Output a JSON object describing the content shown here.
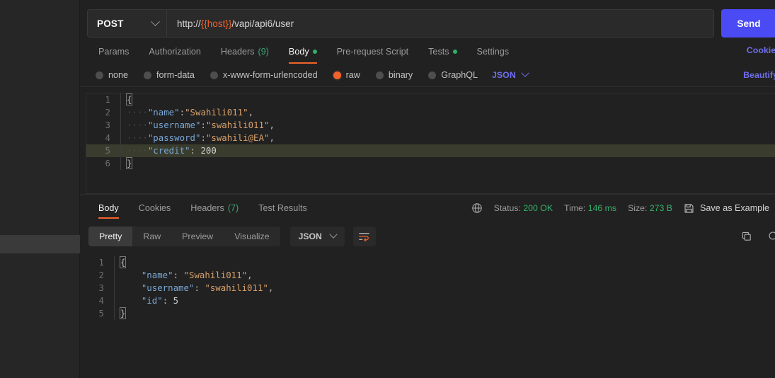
{
  "sidebar": {
    "highlighted_row": ""
  },
  "request": {
    "method": "POST",
    "url_scheme": "http://",
    "url_variable": "{{host}}",
    "url_path": "/vapi/api6/user",
    "send_label": "Send",
    "cookies_link": "Cookies",
    "beautify_link": "Beautify",
    "tabs": [
      {
        "label": "Params",
        "active": false
      },
      {
        "label": "Authorization",
        "active": false
      },
      {
        "label": "Headers",
        "count": "(9)",
        "active": false
      },
      {
        "label": "Body",
        "active": true,
        "dot": true
      },
      {
        "label": "Pre-request Script",
        "active": false
      },
      {
        "label": "Tests",
        "active": false,
        "dot": true
      },
      {
        "label": "Settings",
        "active": false
      }
    ],
    "body_types": [
      {
        "label": "none",
        "selected": false
      },
      {
        "label": "form-data",
        "selected": false
      },
      {
        "label": "x-www-form-urlencoded",
        "selected": false
      },
      {
        "label": "raw",
        "selected": true
      },
      {
        "label": "binary",
        "selected": false
      },
      {
        "label": "GraphQL",
        "selected": false
      }
    ],
    "raw_format": "JSON",
    "body_lines": [
      {
        "n": "1",
        "type": "open"
      },
      {
        "n": "2",
        "type": "kv",
        "key": "\"name\"",
        "sep": ":",
        "value": "\"Swahili011\"",
        "value_kind": "string",
        "trail": ","
      },
      {
        "n": "3",
        "type": "kv",
        "key": "\"username\"",
        "sep": ":",
        "value": "\"swahili011\"",
        "value_kind": "string",
        "trail": ","
      },
      {
        "n": "4",
        "type": "kv",
        "key": "\"password\"",
        "sep": ":",
        "value": "\"swahili@EA\"",
        "value_kind": "string",
        "trail": ","
      },
      {
        "n": "5",
        "type": "kv",
        "key": "\"credit\"",
        "sep": ": ",
        "value": "200",
        "value_kind": "number",
        "trail": "",
        "highlight": true
      },
      {
        "n": "6",
        "type": "close"
      }
    ]
  },
  "response": {
    "tabs": [
      {
        "label": "Body",
        "active": true
      },
      {
        "label": "Cookies",
        "active": false
      },
      {
        "label": "Headers",
        "count": "(7)",
        "active": false
      },
      {
        "label": "Test Results",
        "active": false
      }
    ],
    "status_label": "Status:",
    "status_value": "200 OK",
    "time_label": "Time:",
    "time_value": "146 ms",
    "size_label": "Size:",
    "size_value": "273 B",
    "save_example_label": "Save as Example",
    "view_modes": [
      {
        "label": "Pretty",
        "active": true
      },
      {
        "label": "Raw",
        "active": false
      },
      {
        "label": "Preview",
        "active": false
      },
      {
        "label": "Visualize",
        "active": false
      }
    ],
    "format": "JSON",
    "body_lines": [
      {
        "n": "1",
        "type": "open"
      },
      {
        "n": "2",
        "type": "kv",
        "key": "\"name\"",
        "sep": ": ",
        "value": "\"Swahili011\"",
        "value_kind": "string",
        "trail": ","
      },
      {
        "n": "3",
        "type": "kv",
        "key": "\"username\"",
        "sep": ": ",
        "value": "\"swahili011\"",
        "value_kind": "string",
        "trail": ","
      },
      {
        "n": "4",
        "type": "kv",
        "key": "\"id\"",
        "sep": ": ",
        "value": "5",
        "value_kind": "number",
        "trail": ""
      },
      {
        "n": "5",
        "type": "close"
      }
    ]
  },
  "colors": {
    "accent_orange": "#f1622b",
    "send_blue": "#4b4bf5",
    "link_blue": "#6e6eec",
    "status_green": "#37b26c",
    "highlight_olive": "#3a3d2e"
  }
}
